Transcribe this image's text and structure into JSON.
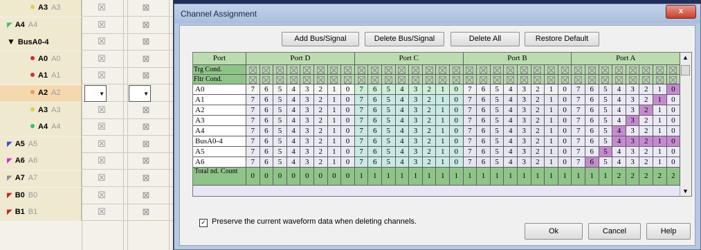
{
  "background_list": {
    "channels": [
      {
        "name": "A3",
        "alias": "A3",
        "icon": "yellow-dot-icon",
        "color": "#e0d040",
        "style": "dot",
        "selected": false
      },
      {
        "name": "A4",
        "alias": "A4",
        "icon": "green-probe-icon",
        "color": "#3cc26c",
        "style": "probe",
        "selected": false
      },
      {
        "name": "BusA0-4",
        "alias": "",
        "icon": "expand-triangle-icon",
        "color": "#000000",
        "style": "triangle",
        "selected": false
      },
      {
        "name": "A0",
        "alias": "A0",
        "icon": "red-dot-icon",
        "color": "#d0303a",
        "style": "dot",
        "selected": false
      },
      {
        "name": "A1",
        "alias": "A1",
        "icon": "red-dot-icon",
        "color": "#d0303a",
        "style": "dot",
        "selected": false
      },
      {
        "name": "A2",
        "alias": "A2",
        "icon": "orange-dot-icon",
        "color": "#e89a50",
        "style": "dot",
        "selected": true
      },
      {
        "name": "A3",
        "alias": "A3",
        "icon": "yellow-dot-icon",
        "color": "#e0d040",
        "style": "dot",
        "selected": false
      },
      {
        "name": "A4",
        "alias": "A4",
        "icon": "green-dot-icon",
        "color": "#30c070",
        "style": "dot",
        "selected": false
      },
      {
        "name": "A5",
        "alias": "A5",
        "icon": "blue-probe-icon",
        "color": "#3050d0",
        "style": "probe",
        "selected": false
      },
      {
        "name": "A6",
        "alias": "A6",
        "icon": "magenta-probe-icon",
        "color": "#d030c8",
        "style": "probe",
        "selected": false
      },
      {
        "name": "A7",
        "alias": "A7",
        "icon": "gray-probe-icon",
        "color": "#909090",
        "style": "probe",
        "selected": false
      },
      {
        "name": "B0",
        "alias": "B0",
        "icon": "red-probe-icon",
        "color": "#c82020",
        "style": "probe",
        "selected": false
      },
      {
        "name": "B1",
        "alias": "B1",
        "icon": "red-probe-icon",
        "color": "#c82020",
        "style": "probe",
        "selected": false
      }
    ]
  },
  "dialog": {
    "title": "Channel Assignment",
    "close_label": "x",
    "buttons": {
      "add": "Add Bus/Signal",
      "delete": "Delete Bus/Signal",
      "delete_all": "Delete All",
      "restore": "Restore Default"
    },
    "grid": {
      "port_label": "Port",
      "ports": [
        "Port D",
        "Port C",
        "Port B",
        "Port A"
      ],
      "cond_labels": [
        "Trg Cond.",
        "Fltr Cond."
      ],
      "bits": [
        "7",
        "6",
        "5",
        "4",
        "3",
        "2",
        "1",
        "0"
      ],
      "rows": [
        {
          "name": "A0",
          "highlight": [
            31
          ]
        },
        {
          "name": "A1",
          "highlight": [
            30
          ]
        },
        {
          "name": "A2",
          "highlight": [
            29
          ]
        },
        {
          "name": "A3",
          "highlight": [
            28
          ]
        },
        {
          "name": "A4",
          "highlight": [
            27
          ]
        },
        {
          "name": "BusA0-4",
          "highlight": [
            27,
            28,
            29,
            30,
            31
          ]
        },
        {
          "name": "A5",
          "highlight": [
            26
          ]
        },
        {
          "name": "A6",
          "highlight": [
            25
          ]
        }
      ],
      "total_label": "Total nd. Count",
      "totals": [
        "0",
        "0",
        "0",
        "0",
        "0",
        "0",
        "0",
        "0",
        "1",
        "1",
        "1",
        "1",
        "1",
        "1",
        "1",
        "1",
        "1",
        "1",
        "1",
        "1",
        "1",
        "1",
        "1",
        "1",
        "1",
        "1",
        "1",
        "2",
        "2",
        "2",
        "2",
        "2"
      ]
    },
    "preserve_label": "Preserve the current waveform data when deleting channels.",
    "preserve_checked": true,
    "ok": "Ok",
    "cancel": "Cancel",
    "help": "Help"
  }
}
